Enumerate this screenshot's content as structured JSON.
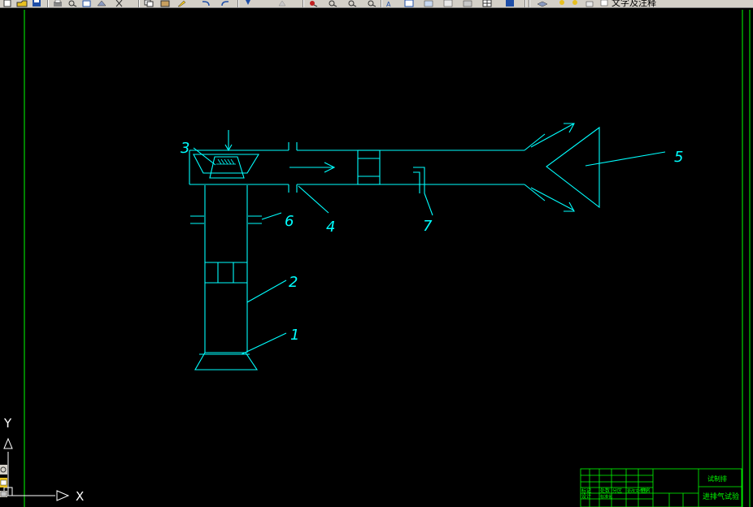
{
  "toolbar": {
    "layer_name": "文字及注释",
    "colors": {
      "bg": "#d4d0c8",
      "icon_blue": "#1f4fa8",
      "icon_yellow": "#e8c020",
      "icon_red": "#c02020"
    }
  },
  "drawing": {
    "background": "#000000",
    "line_color": "#00ffff",
    "frame_color": "#00ff00",
    "labels": {
      "l1": "1",
      "l2": "2",
      "l3": "3",
      "l4": "4",
      "l5": "5",
      "l6": "6",
      "l7": "7"
    }
  },
  "ucs": {
    "x_label": "X",
    "y_label": "Y"
  },
  "title_block": {
    "project": "试制排",
    "drawing_name": "进排气试验",
    "small_a": "标记",
    "small_b": "处数",
    "small_c": "分区",
    "small_d": "更改文件号",
    "small_e": "签名",
    "row_a": "设计",
    "row_b": "标准化"
  }
}
